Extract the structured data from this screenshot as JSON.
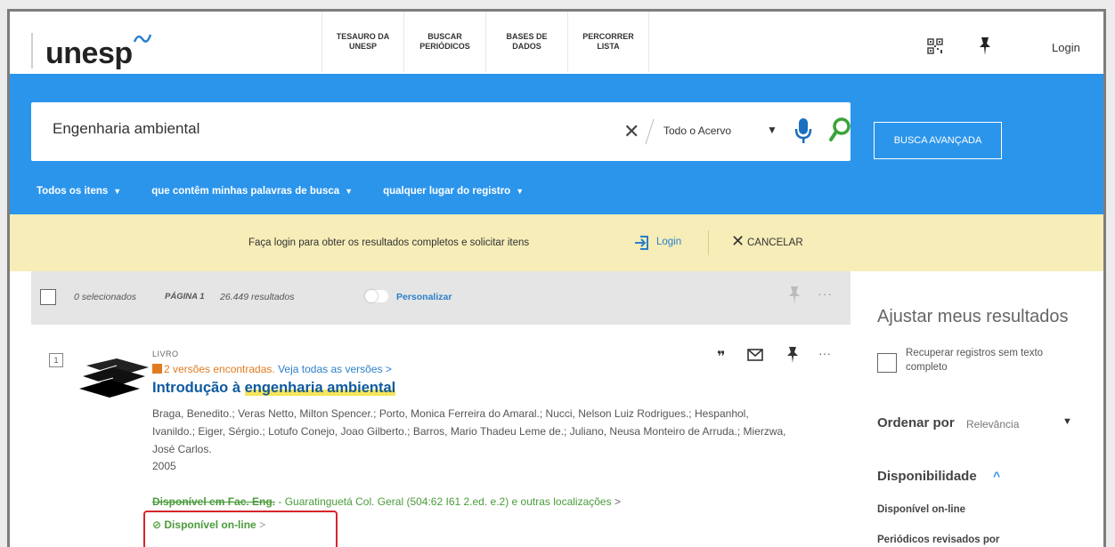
{
  "header": {
    "logo": "unesp",
    "nav": [
      {
        "label": "TESAURO DA\nUNESP"
      },
      {
        "label": "BUSCAR\nPERIÓDICOS"
      },
      {
        "label": "BASES DE\nDADOS"
      },
      {
        "label": "PERCORRER\nLISTA"
      }
    ],
    "login": "Login"
  },
  "search": {
    "query": "Engenharia ambiental",
    "scope": "Todo o Acervo",
    "advanced": "BUSCA AVANÇADA",
    "filters": [
      {
        "label": "Todos os itens"
      },
      {
        "label": "que contêm minhas palavras de busca"
      },
      {
        "label": "qualquer lugar do registro"
      }
    ]
  },
  "login_banner": {
    "text": "Faça login para obter os resultados completos e solicitar itens",
    "login": "Login",
    "cancel": "CANCELAR"
  },
  "toolbar": {
    "selected": "0 selecionados",
    "page": "PÁGINA 1",
    "results": "26.449 resultados",
    "personalize": "Personalizar"
  },
  "result": {
    "index": "1",
    "type": "LIVRO",
    "versions_found": "2 versões encontradas.",
    "versions_all": "Veja todas as versões",
    "title_prefix": "Introdução à ",
    "title_highlight": "engenharia ambiental",
    "authors": "Braga, Benedito.; Veras Netto, Milton Spencer.; Porto, Monica Ferreira do Amaral.; Nucci, Nelson Luiz Rodrigues.; Hespanhol, Ivanildo.; Eiger, Sérgio.; Lotufo Conejo, Joao Gilberto.; Barros, Mario Thadeu Leme de.; Juliano, Neusa Monteiro de Arruda.; Mierzwa, José Carlos.",
    "year": "2005",
    "availability_strike": "Disponível em Fac. Eng.",
    "availability_location": " - Guaratinguetá  Col. Geral (504:62 I61 2.ed. e.2) e outras localizações",
    "online": "Disponível on-line"
  },
  "sidebar": {
    "title": "Ajustar meus resultados",
    "checkbox_label": "Recuperar registros sem texto completo",
    "sort_label": "Ordenar por",
    "sort_value": "Relevância",
    "availability": "Disponibilidade",
    "filters": [
      {
        "label": "Disponível on-line"
      },
      {
        "label": "Periódicos revisados por"
      }
    ]
  },
  "colors": {
    "brand_blue": "#2b95ec",
    "banner_yellow": "#f6edb8",
    "available_green": "#4a9b3b",
    "versions_orange": "#e07b21",
    "highlight_box": "#d8242c"
  }
}
